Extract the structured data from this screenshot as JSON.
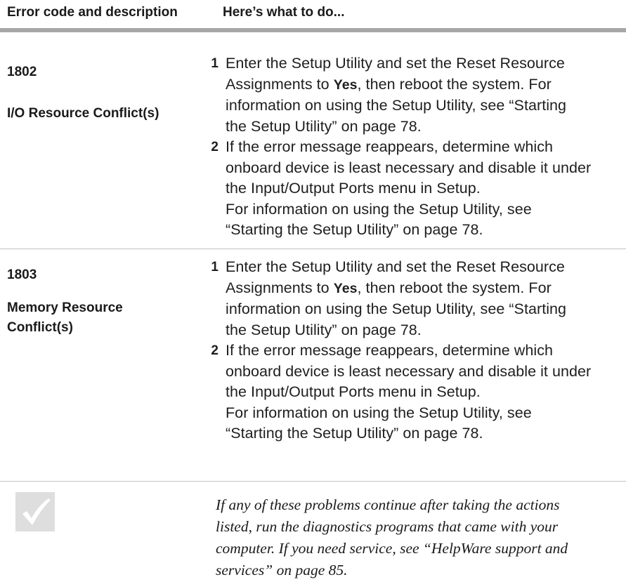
{
  "header": {
    "col1": "Error code and description",
    "col2": "Here’s what to do..."
  },
  "entries": [
    {
      "code": "1802",
      "description": "I/O Resource Conflict(s)",
      "desc_lines": [
        "I/O Resource Conflict(s)"
      ],
      "steps": [
        {
          "number": "1",
          "lines": [
            {
              "text": "Enter the Setup Utility and set the Reset Resource"
            },
            {
              "pre": "Assignments to ",
              "bold": "Yes",
              "post": ", then reboot the system. For"
            },
            {
              "text": "information on using the Setup Utility, see “Starting"
            },
            {
              "text": "the Setup Utility” on page 78."
            }
          ]
        },
        {
          "number": "2",
          "lines": [
            {
              "text": "If the error message reappears, determine which"
            },
            {
              "text": "onboard device is least necessary and disable it under"
            },
            {
              "text": "the Input/Output Ports menu in Setup."
            },
            {
              "text": "For information on using the Setup Utility, see"
            },
            {
              "text": "“Starting the Setup Utility” on page 78."
            }
          ]
        }
      ]
    },
    {
      "code": "1803",
      "description": "Memory Resource Conflict(s)",
      "desc_lines": [
        "Memory Resource",
        "Conflict(s)"
      ],
      "steps": [
        {
          "number": "1",
          "lines": [
            {
              "text": "Enter the Setup Utility and set the Reset Resource"
            },
            {
              "pre": "Assignments to ",
              "bold": "Yes",
              "post": ", then reboot the system. For"
            },
            {
              "text": "information on using the Setup Utility, see “Starting"
            },
            {
              "text": "the Setup Utility” on page 78."
            }
          ]
        },
        {
          "number": "2",
          "lines": [
            {
              "text": "If the error message reappears, determine which"
            },
            {
              "text": "onboard device is least necessary and disable it under"
            },
            {
              "text": "the Input/Output Ports menu in Setup."
            },
            {
              "text": "For information on using the Setup Utility, see"
            },
            {
              "text": "“Starting the Setup Utility” on page 78."
            }
          ]
        }
      ]
    }
  ],
  "note": {
    "icon": "checkmark-icon",
    "lines": [
      "If any of these problems continue after taking the actions",
      "listed, run the diagnostics programs that came with your",
      "computer. If you need service, see “HelpWare support and",
      "services” on page 85."
    ]
  }
}
